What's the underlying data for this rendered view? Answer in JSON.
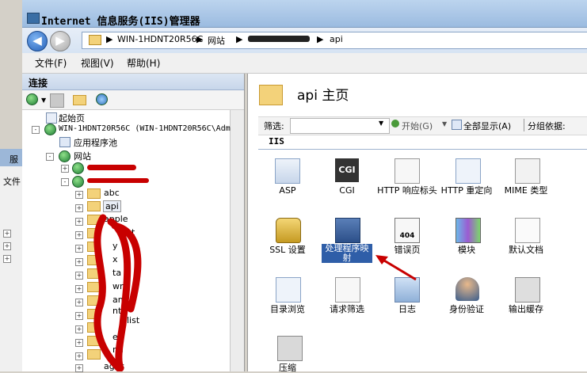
{
  "window": {
    "title": "Internet 信息服务(IIS)管理器"
  },
  "address": {
    "crumbs": [
      "WIN-1HDNT20R56C",
      "网站",
      "api"
    ],
    "separator": "▶"
  },
  "menu": [
    "文件(F)",
    "视图(V)",
    "帮助(H)"
  ],
  "connections": {
    "title": "连接",
    "tree": {
      "start_page": "起始页",
      "server": "WIN-1HDNT20R56C (WIN-1HDNT20R56C\\Adm",
      "app_pools": "应用程序池",
      "sites": "网站",
      "folders": [
        "abc",
        "api",
        "apple"
      ],
      "partial_labels": [
        "t",
        "y",
        "x",
        "ta",
        "wn",
        "am",
        "nt",
        "list",
        "e",
        "ml",
        "ages"
      ]
    }
  },
  "home": {
    "title": "api 主页",
    "filter_label": "筛选:",
    "start_label": "开始(G)",
    "show_all_label": "全部显示(A)",
    "group_label": "分组依据:",
    "section": "IIS"
  },
  "features": [
    {
      "icon": "asp-icon",
      "label": "ASP"
    },
    {
      "icon": "cgi-icon",
      "label": "CGI",
      "icon_text": "CGI"
    },
    {
      "icon": "http-response-headers-icon",
      "label": "HTTP 响应标头"
    },
    {
      "icon": "http-redirect-icon",
      "label": "HTTP 重定向"
    },
    {
      "icon": "mime-types-icon",
      "label": "MIME 类型"
    },
    {
      "icon": "ssl-settings-icon",
      "label": "SSL 设置"
    },
    {
      "icon": "handler-mappings-icon",
      "label": "处理程序映射"
    },
    {
      "icon": "error-pages-icon",
      "label": "错误页",
      "icon_text": "404"
    },
    {
      "icon": "modules-icon",
      "label": "模块"
    },
    {
      "icon": "default-document-icon",
      "label": "默认文档"
    },
    {
      "icon": "directory-browsing-icon",
      "label": "目录浏览"
    },
    {
      "icon": "request-filtering-icon",
      "label": "请求筛选"
    },
    {
      "icon": "logging-icon",
      "label": "日志"
    },
    {
      "icon": "authentication-icon",
      "label": "身份验证"
    },
    {
      "icon": "output-caching-icon",
      "label": "输出缓存"
    },
    {
      "icon": "compression-icon",
      "label": "压缩"
    }
  ],
  "background_window": {
    "title": "服",
    "menu": "文件"
  },
  "colors": {
    "selection": "#2f5ea8",
    "annotation": "#c80000",
    "accent": "#3a6ea5"
  }
}
